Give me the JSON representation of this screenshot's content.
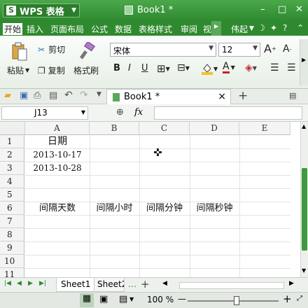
{
  "app": {
    "brand": "WPS 表格",
    "brand_letter": "S",
    "doc_title": "Book1 *",
    "window_buttons": [
      "–",
      "□",
      "✕"
    ]
  },
  "menubar": {
    "items": [
      "开始",
      "插入",
      "页面布局",
      "公式",
      "数据",
      "表格样式",
      "审阅",
      "视"
    ],
    "user": "伟起"
  },
  "ribbon": {
    "paste": "粘贴",
    "cut": "剪切",
    "copy": "复制",
    "format_painter": "格式刷",
    "font_name": "宋体",
    "font_size": "12",
    "grow": "A",
    "shrink": "A",
    "bold": "B",
    "italic": "I",
    "underline": "U",
    "font_color_letter": "A"
  },
  "tabs": {
    "doc_tab": "Book1 *",
    "close": "×",
    "new": "+"
  },
  "formula": {
    "name_box": "J13",
    "fx": "fx",
    "value": ""
  },
  "grid": {
    "columns": [
      "A",
      "B",
      "C",
      "D",
      "E"
    ],
    "rows": [
      "1",
      "2",
      "3",
      "4",
      "5",
      "6",
      "7",
      "8",
      "9",
      "10",
      "11"
    ],
    "cells": {
      "A1": "日期",
      "A2": "2013-10-17",
      "A3": "2013-10-28",
      "A6": "间隔天数",
      "B6": "间隔小时",
      "C6": "间隔分钟",
      "D6": "间隔秒钟"
    }
  },
  "sheets": {
    "tabs": [
      "Sheet1",
      "Sheet2"
    ],
    "more": "…",
    "add": "+"
  },
  "status": {
    "zoom": "100 %",
    "zoom_minus": "—",
    "zoom_plus": "+",
    "zoom_level": 0.5
  },
  "colors": {
    "accent": "#3d9a3d",
    "menubar": "#2f8a2f"
  }
}
